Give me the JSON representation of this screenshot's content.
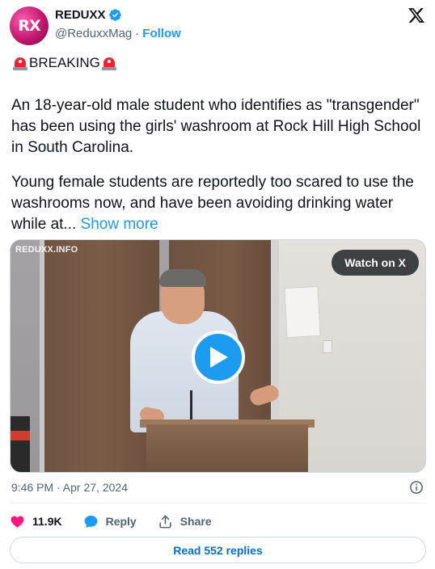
{
  "author": {
    "display_name": "REDUXX",
    "handle": "@ReduxxMag",
    "separator": "·",
    "follow_label": "Follow",
    "avatar_initials": "RX",
    "verified": true
  },
  "tweet": {
    "breaking_label": "BREAKING",
    "paragraph1": "An 18-year-old male student who identifies as \"transgender\" has been using the girls' washroom at Rock Hill High School in South Carolina.",
    "paragraph2": "Young female students are reportedly too scared to use the washrooms now, and have been avoiding drinking water while at...",
    "show_more_label": "Show more"
  },
  "media": {
    "watermark": "REDUXX.INFO",
    "watch_label": "Watch on X"
  },
  "meta": {
    "timestamp": "9:46 PM · Apr 27, 2024"
  },
  "actions": {
    "likes": "11.9K",
    "reply_label": "Reply",
    "share_label": "Share"
  },
  "footer": {
    "read_replies_label": "Read 552 replies"
  },
  "colors": {
    "accent": "#1d9bf0",
    "like": "#f91880",
    "text": "#0f1419",
    "muted": "#536471"
  },
  "icons": [
    "verified-badge-icon",
    "x-logo-icon",
    "siren-icon",
    "play-icon",
    "info-icon",
    "heart-icon",
    "reply-bubble-icon",
    "share-icon"
  ]
}
